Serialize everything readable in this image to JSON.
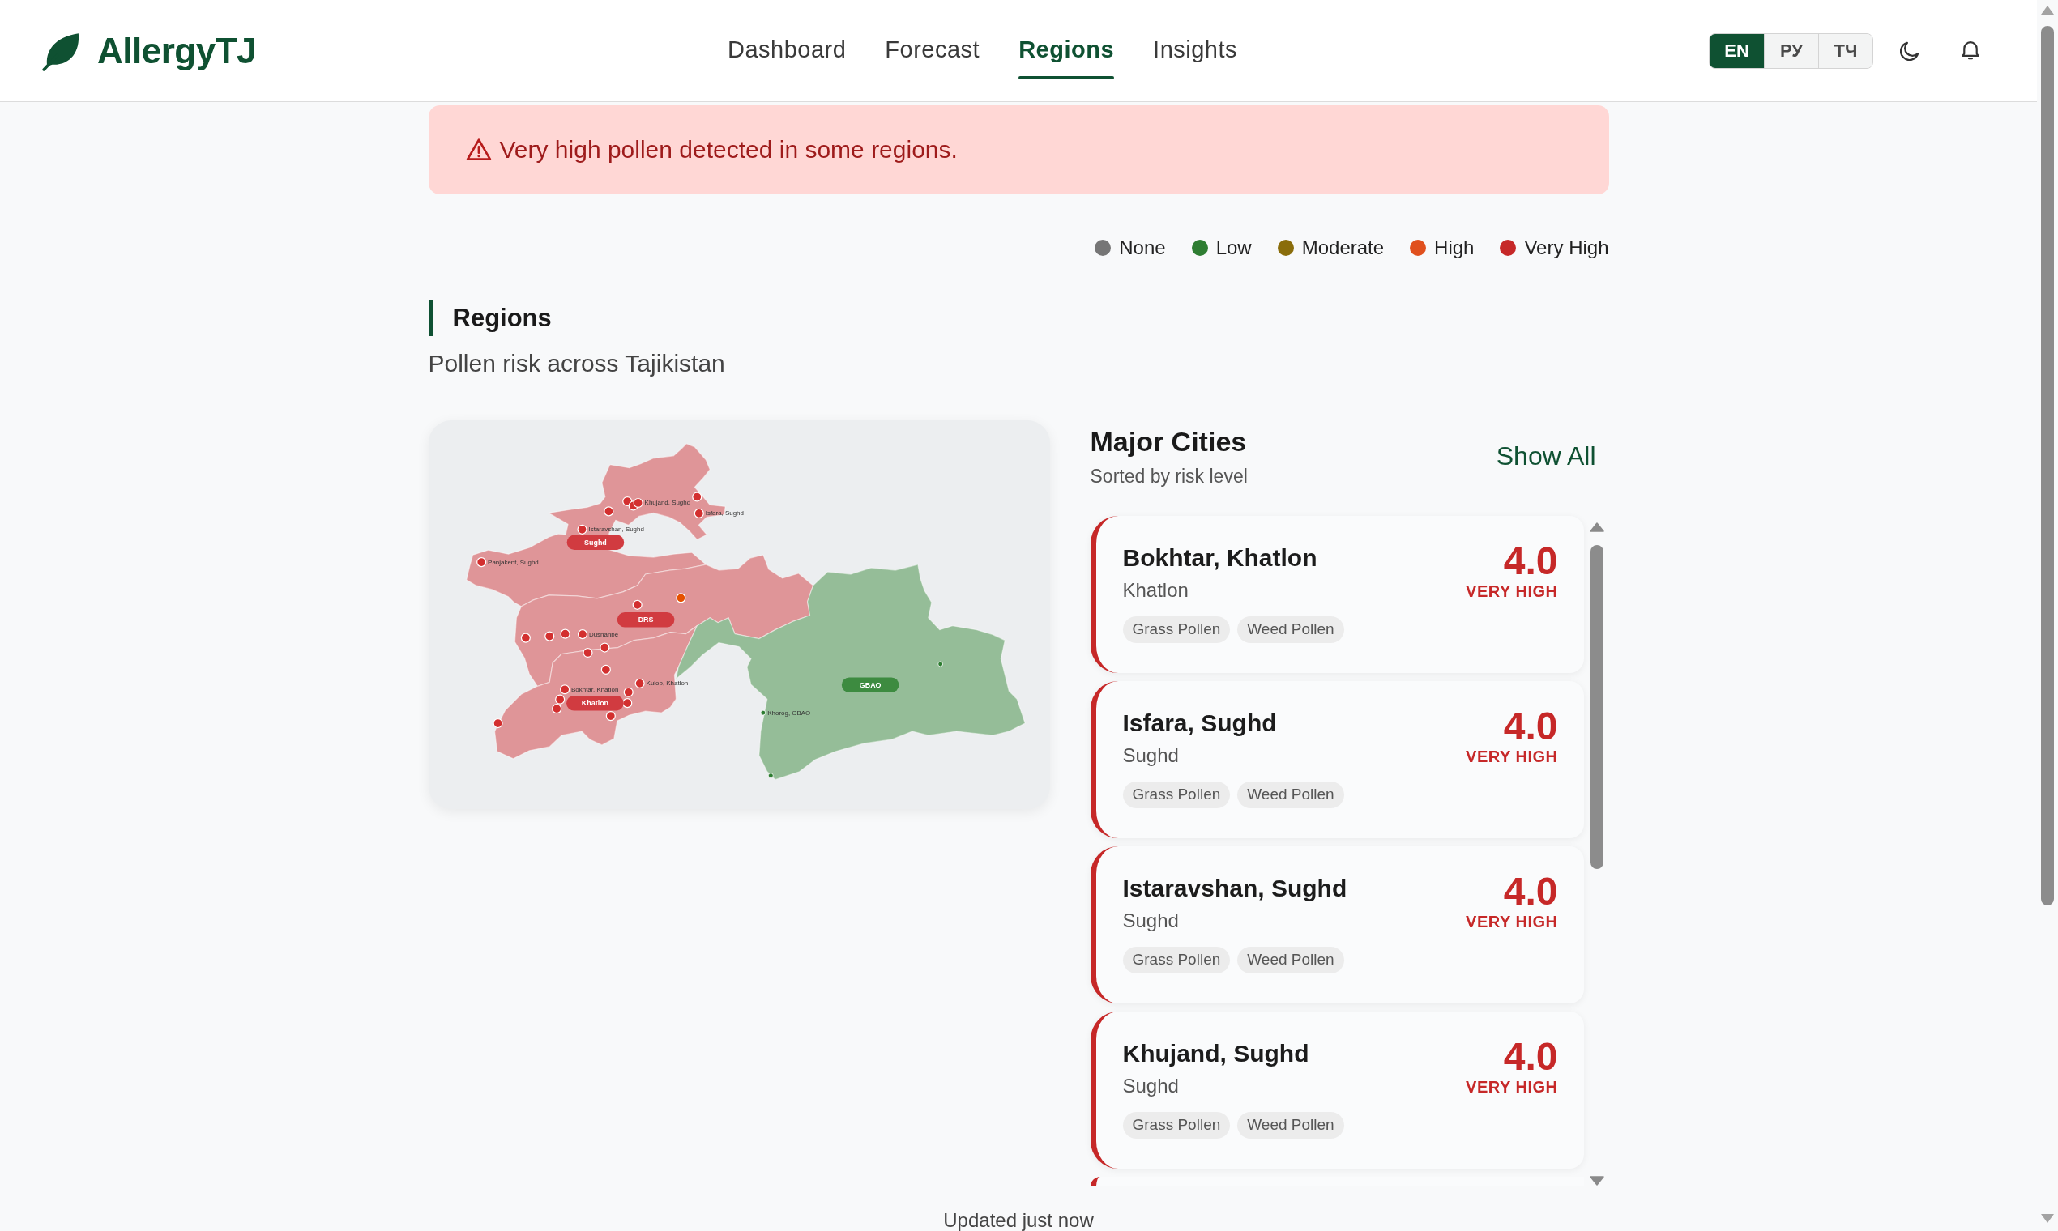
{
  "header": {
    "logo": "AllergyTJ",
    "nav": [
      {
        "label": "Dashboard",
        "selected": false
      },
      {
        "label": "Forecast",
        "selected": false
      },
      {
        "label": "Regions",
        "selected": true
      },
      {
        "label": "Insights",
        "selected": false
      }
    ],
    "languages": [
      {
        "label": "EN",
        "selected": true
      },
      {
        "label": "РУ",
        "selected": false
      },
      {
        "label": "ТЧ",
        "selected": false
      }
    ]
  },
  "alert": {
    "text": "Very high pollen detected in some regions."
  },
  "legend": [
    {
      "label": "None",
      "color": "#767676"
    },
    {
      "label": "Low",
      "color": "#2e7d32"
    },
    {
      "label": "Moderate",
      "color": "#8a6d0b"
    },
    {
      "label": "High",
      "color": "#e0501e"
    },
    {
      "label": "Very High",
      "color": "#c62828"
    }
  ],
  "page": {
    "title": "Regions",
    "subtitle": "Pollen risk across Tajikistan"
  },
  "map": {
    "regions": [
      {
        "name": "Sughd",
        "color": "#d13b40"
      },
      {
        "name": "DRS",
        "color": "#d13b40"
      },
      {
        "name": "Khatlon",
        "color": "#d13b40"
      },
      {
        "name": "GBAO",
        "color": "#3d8b40"
      }
    ],
    "markers": [
      {
        "kind": "major",
        "color": "#d32f2f"
      },
      {
        "kind": "major",
        "color": "#d32f2f"
      },
      {
        "kind": "major",
        "color": "#d32f2f",
        "label": "Khujand, Sughd"
      },
      {
        "kind": "major",
        "color": "#d32f2f"
      },
      {
        "kind": "major",
        "color": "#d32f2f"
      },
      {
        "kind": "major",
        "color": "#d32f2f",
        "label": "Isfara, Sughd"
      },
      {
        "kind": "major",
        "color": "#d32f2f",
        "label": "Istaravshan, Sughd"
      },
      {
        "kind": "major",
        "color": "#d32f2f",
        "label": "Panjakent, Sughd"
      },
      {
        "kind": "major",
        "color": "#e65100"
      },
      {
        "kind": "major",
        "color": "#d32f2f"
      },
      {
        "kind": "major",
        "color": "#d32f2f"
      },
      {
        "kind": "major",
        "color": "#d32f2f"
      },
      {
        "kind": "major",
        "color": "#d32f2f"
      },
      {
        "kind": "major",
        "color": "#d32f2f",
        "label": "Dushanbe"
      },
      {
        "kind": "major",
        "color": "#d32f2f"
      },
      {
        "kind": "major",
        "color": "#d32f2f"
      },
      {
        "kind": "major",
        "color": "#d32f2f"
      },
      {
        "kind": "major",
        "color": "#d32f2f",
        "label": "Kulob, Khatlon"
      },
      {
        "kind": "major",
        "color": "#d32f2f",
        "label": "Bokhtar, Khatlon"
      },
      {
        "kind": "major",
        "color": "#d32f2f"
      },
      {
        "kind": "major",
        "color": "#d32f2f"
      },
      {
        "kind": "major",
        "color": "#d32f2f"
      },
      {
        "kind": "major",
        "color": "#d32f2f"
      },
      {
        "kind": "major",
        "color": "#d32f2f"
      },
      {
        "kind": "major",
        "color": "#d32f2f"
      },
      {
        "kind": "minor",
        "color": "#2e7d32"
      },
      {
        "kind": "minor",
        "color": "#2e7d32",
        "label": "Khorog, GBAO"
      },
      {
        "kind": "minor",
        "color": "#2e7d32"
      }
    ]
  },
  "cities": {
    "title": "Major Cities",
    "subtitle": "Sorted by risk level",
    "action": "Show All",
    "items": [
      {
        "name": "Bokhtar, Khatlon",
        "region": "Khatlon",
        "score": "4.0",
        "risk": "VERY HIGH",
        "color": "#c62828",
        "tags": [
          "Grass Pollen",
          "Weed Pollen"
        ]
      },
      {
        "name": "Isfara, Sughd",
        "region": "Sughd",
        "score": "4.0",
        "risk": "VERY HIGH",
        "color": "#c62828",
        "tags": [
          "Grass Pollen",
          "Weed Pollen"
        ]
      },
      {
        "name": "Istaravshan, Sughd",
        "region": "Sughd",
        "score": "4.0",
        "risk": "VERY HIGH",
        "color": "#c62828",
        "tags": [
          "Grass Pollen",
          "Weed Pollen"
        ]
      },
      {
        "name": "Khujand, Sughd",
        "region": "Sughd",
        "score": "4.0",
        "risk": "VERY HIGH",
        "color": "#c62828",
        "tags": [
          "Grass Pollen",
          "Weed Pollen"
        ]
      },
      {
        "color": "#c62828"
      }
    ]
  },
  "footer": {
    "updated": "Updated just now"
  }
}
